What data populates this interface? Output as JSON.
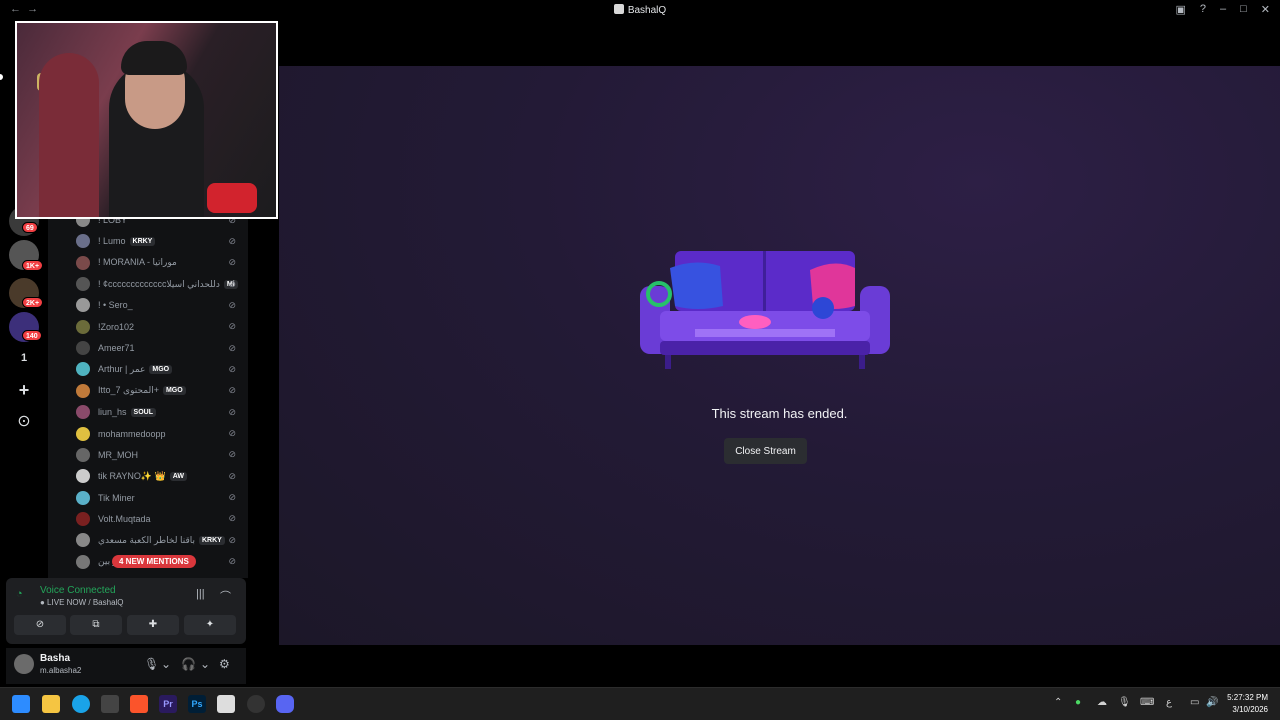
{
  "window": {
    "title": "BashalQ",
    "back": "←",
    "forward": "→"
  },
  "servers": {
    "badges": [
      "69",
      "1K+",
      "2K+",
      "140"
    ],
    "count": "1",
    "add_symbol": "+",
    "explore_symbol": "⊙"
  },
  "members": [
    {
      "name": "! LOBY",
      "tag": ""
    },
    {
      "name": "! Lumo",
      "tag": "KRKY"
    },
    {
      "name": "! MORANIA - موراتيا",
      "tag": ""
    },
    {
      "name": "! ¢cccccccccccccدللحداني اسيلا",
      "tag": "Mi"
    },
    {
      "name": "! • Sero_",
      "tag": ""
    },
    {
      "name": "!Zoro102",
      "tag": ""
    },
    {
      "name": "Ameer71",
      "tag": ""
    },
    {
      "name": "Arthur | عمر",
      "tag": "MGO"
    },
    {
      "name": "Itto_7 المحتوى+",
      "tag": "MGO"
    },
    {
      "name": "liun_hs",
      "tag": "SOUL"
    },
    {
      "name": "mohammedoopp",
      "tag": ""
    },
    {
      "name": "MR_MOH",
      "tag": ""
    },
    {
      "name": "tik RAYNO✨ 👑",
      "tag": "AW"
    },
    {
      "name": "Tik Miner",
      "tag": ""
    },
    {
      "name": "Volt.Muqtada",
      "tag": ""
    },
    {
      "name": "باقنا لخاطر الكعبة مسعدي",
      "tag": "KRKY"
    },
    {
      "name": "صاحب فراز بين",
      "tag": ""
    }
  ],
  "mentions_label": "4 NEW MENTIONS",
  "voice": {
    "title": "Voice Connected",
    "subtitle": "● LIVE NOW / BashalQ"
  },
  "user": {
    "name": "Basha",
    "handle": "m.albasha2"
  },
  "stream": {
    "ended_text": "This stream has ended.",
    "close_label": "Close Stream"
  },
  "taskbar": {
    "time": "5:27:32 PM",
    "date": "3/10/2026",
    "apps": [
      "Pr",
      "Ps"
    ],
    "lang": "ع"
  },
  "colors": {
    "accent_green": "#23a55a",
    "mention_red": "#da373c",
    "discord": "#5865f2"
  }
}
